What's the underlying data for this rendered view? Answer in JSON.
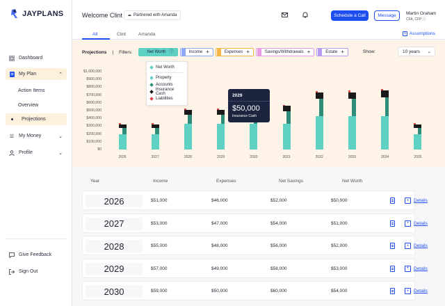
{
  "app": {
    "logo_text": "JAYPLANS"
  },
  "sidebar": {
    "items": [
      {
        "label": "Dashboard",
        "icon": "grid-icon"
      },
      {
        "label": "My Plan",
        "icon": "document-icon"
      },
      {
        "label": "My Money",
        "icon": "money-icon"
      },
      {
        "label": "Profile",
        "icon": "person-icon"
      }
    ],
    "subitems": [
      {
        "label": "Action Items"
      },
      {
        "label": "Overview"
      },
      {
        "label": "Projections"
      }
    ],
    "footer": [
      {
        "label": "Give Feedback",
        "icon": "chat-icon"
      },
      {
        "label": "Sign Out",
        "icon": "logout-icon"
      }
    ]
  },
  "header": {
    "welcome": "Welcome Clint",
    "partner": "Partnered with Amanda",
    "schedule_label": "Schedule a Call",
    "message_label": "Message",
    "user_name": "Martin Graham",
    "user_creds": "CFA, CFP ⓘ"
  },
  "tabs": [
    {
      "label": "All"
    },
    {
      "label": "Clint"
    },
    {
      "label": "Amanda"
    }
  ],
  "assumptions_label": "Assumptions",
  "filters": {
    "section_label": "Projections",
    "separator": "|",
    "filters_label": "Filters:",
    "chips": [
      {
        "label": "Net Worth",
        "color": "#5fd1c4",
        "active": true,
        "suffix": "ⓘ"
      },
      {
        "label": "Income",
        "color": "#8fa8f5",
        "active": false,
        "suffix": "+"
      },
      {
        "label": "Expenses",
        "color": "#f5b547",
        "active": false,
        "suffix": "+"
      },
      {
        "label": "Savings/Withdrawals",
        "color": "#e79be7",
        "active": false,
        "suffix": "+"
      },
      {
        "label": "Estate",
        "color": "#b59cf2",
        "active": false,
        "suffix": "+"
      }
    ],
    "show_label": "Show:",
    "show_value": "10 years"
  },
  "dropdown": {
    "header": "Net Worth",
    "items": [
      {
        "label": "Property",
        "color": "#5fd1c4"
      },
      {
        "label": "Accounts",
        "color": "#2e8c78"
      },
      {
        "label": "Insurance Cash",
        "color": "#1a1a1a"
      },
      {
        "label": "Liabilities",
        "color": "#e04848"
      }
    ]
  },
  "tooltip": {
    "year": "2029",
    "value": "$50,000",
    "label": "Insurance Cash"
  },
  "chart_data": {
    "type": "bar",
    "stacked": true,
    "categories": [
      "2026",
      "2027",
      "2028",
      "2029",
      "2030",
      "2031",
      "2032",
      "2033",
      "2034",
      "2035"
    ],
    "yticks": [
      "$1,000,000",
      "$900,000",
      "$800,000",
      "$700,000",
      "$600,000",
      "$500,000",
      "$400,000",
      "$300,000",
      "$200,000",
      "$100,000",
      "$0"
    ],
    "ylim": [
      0,
      1000000
    ],
    "series": [
      {
        "name": "Property",
        "color": "#5fd1c4",
        "values": [
          200000,
          200000,
          330000,
          330000,
          330000,
          330000,
          430000,
          430000,
          430000,
          200000
        ]
      },
      {
        "name": "Accounts",
        "color": "#2e8c78",
        "values": [
          80000,
          80000,
          120000,
          120000,
          160000,
          160000,
          220000,
          220000,
          240000,
          80000
        ]
      },
      {
        "name": "Insurance Cash",
        "color": "#1a1a1a",
        "values": [
          40000,
          40000,
          60000,
          60000,
          60000,
          70000,
          80000,
          85000,
          90000,
          40000
        ]
      },
      {
        "name": "Liabilities",
        "color": "#e04848",
        "values": [
          15000,
          15000,
          15000,
          15000,
          15000,
          15000,
          20000,
          20000,
          20000,
          15000
        ]
      }
    ],
    "grid": false,
    "legend": "dropdown"
  },
  "table": {
    "headers": [
      "Year",
      "Income",
      "Expenses",
      "Net Savings",
      "Net Worth"
    ],
    "details_label": "Details",
    "rows": [
      {
        "year": "2026",
        "income": "$51,000",
        "expenses": "$46,000",
        "savings": "$52,000",
        "networth": "$50,000"
      },
      {
        "year": "2027",
        "income": "$53,000",
        "expenses": "$47,000",
        "savings": "$54,000",
        "networth": "$51,000"
      },
      {
        "year": "2028",
        "income": "$55,000",
        "expenses": "$48,000",
        "savings": "$56,000",
        "networth": "$52,000"
      },
      {
        "year": "2029",
        "income": "$57,000",
        "expenses": "$49,000",
        "savings": "$58,000",
        "networth": "$53,000"
      },
      {
        "year": "2030",
        "income": "$59,000",
        "expenses": "$50,000",
        "savings": "$60,000",
        "networth": "$54,000"
      }
    ]
  }
}
